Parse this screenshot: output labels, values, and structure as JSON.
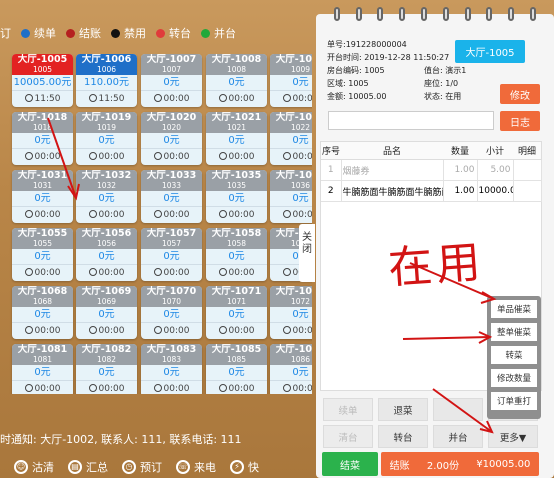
{
  "legend": [
    {
      "label": "订",
      "color": ""
    },
    {
      "label": "续单",
      "color": "#1f6fc8"
    },
    {
      "label": "结账",
      "color": "#b52020"
    },
    {
      "label": "禁用",
      "color": "#111111"
    },
    {
      "label": "转台",
      "color": "#e03b3b"
    },
    {
      "label": "并台",
      "color": "#22a83a"
    }
  ],
  "tables": [
    {
      "name": "大厅-1005",
      "code": "1005",
      "amount": "10005.00元",
      "time": "11:50",
      "status": "red"
    },
    {
      "name": "大厅-1006",
      "code": "1006",
      "amount": "110.00元",
      "time": "11:50",
      "status": "blue"
    },
    {
      "name": "大厅-1007",
      "code": "1007",
      "amount": "0元",
      "time": "00:00",
      "status": "idle"
    },
    {
      "name": "大厅-1008",
      "code": "1008",
      "amount": "0元",
      "time": "00:00",
      "status": "idle"
    },
    {
      "name": "大厅-1009",
      "code": "1009",
      "amount": "0元",
      "time": "00:00",
      "status": "idle"
    },
    {
      "name": "大厅-1018",
      "code": "1018",
      "amount": "0元",
      "time": "00:00",
      "status": "idle"
    },
    {
      "name": "大厅-1019",
      "code": "1019",
      "amount": "0元",
      "time": "00:00",
      "status": "idle"
    },
    {
      "name": "大厅-1020",
      "code": "1020",
      "amount": "0元",
      "time": "00:00",
      "status": "idle"
    },
    {
      "name": "大厅-1021",
      "code": "1021",
      "amount": "0元",
      "time": "00:00",
      "status": "idle"
    },
    {
      "name": "大厅-1022",
      "code": "1022",
      "amount": "0元",
      "time": "00:00",
      "status": "idle"
    },
    {
      "name": "大厅-1031",
      "code": "1031",
      "amount": "0元",
      "time": "00:00",
      "status": "idle"
    },
    {
      "name": "大厅-1032",
      "code": "1032",
      "amount": "0元",
      "time": "00:00",
      "status": "idle"
    },
    {
      "name": "大厅-1033",
      "code": "1033",
      "amount": "0元",
      "time": "00:00",
      "status": "idle"
    },
    {
      "name": "大厅-1035",
      "code": "1035",
      "amount": "0元",
      "time": "00:00",
      "status": "idle"
    },
    {
      "name": "大厅-1036",
      "code": "1036",
      "amount": "0元",
      "time": "00:00",
      "status": "idle"
    },
    {
      "name": "大厅-1055",
      "code": "1055",
      "amount": "0元",
      "time": "00:00",
      "status": "idle"
    },
    {
      "name": "大厅-1056",
      "code": "1056",
      "amount": "0元",
      "time": "00:00",
      "status": "idle"
    },
    {
      "name": "大厅-1057",
      "code": "1057",
      "amount": "0元",
      "time": "00:00",
      "status": "idle"
    },
    {
      "name": "大厅-1058",
      "code": "1058",
      "amount": "0元",
      "time": "00:00",
      "status": "idle"
    },
    {
      "name": "大厅-1059",
      "code": "1059",
      "amount": "0元",
      "time": "00:00",
      "status": "idle"
    },
    {
      "name": "大厅-1068",
      "code": "1068",
      "amount": "0元",
      "time": "00:00",
      "status": "idle"
    },
    {
      "name": "大厅-1069",
      "code": "1069",
      "amount": "0元",
      "time": "00:00",
      "status": "idle"
    },
    {
      "name": "大厅-1070",
      "code": "1070",
      "amount": "0元",
      "time": "00:00",
      "status": "idle"
    },
    {
      "name": "大厅-1071",
      "code": "1071",
      "amount": "0元",
      "time": "00:00",
      "status": "idle"
    },
    {
      "name": "大厅-1072",
      "code": "1072",
      "amount": "0元",
      "time": "00:00",
      "status": "idle"
    },
    {
      "name": "大厅-1081",
      "code": "1081",
      "amount": "0元",
      "time": "00:00",
      "status": "idle"
    },
    {
      "name": "大厅-1082",
      "code": "1082",
      "amount": "0元",
      "time": "00:00",
      "status": "idle"
    },
    {
      "name": "大厅-1083",
      "code": "1083",
      "amount": "0元",
      "time": "00:00",
      "status": "idle"
    },
    {
      "name": "大厅-1085",
      "code": "1085",
      "amount": "0元",
      "time": "00:00",
      "status": "idle"
    },
    {
      "name": "大厅-1086",
      "code": "1086",
      "amount": "0元",
      "time": "00:00",
      "status": "idle"
    }
  ],
  "side_tab": "关闭",
  "notice": "时通知: 大厅-1002, 联系人: 111, 联系电话: 111",
  "bottom_bar": [
    {
      "label": "沽清",
      "icon": "clean-icon"
    },
    {
      "label": "汇总",
      "icon": "summary-icon"
    },
    {
      "label": "预订",
      "icon": "clock-icon"
    },
    {
      "label": "来电",
      "icon": "phone-icon"
    },
    {
      "label": "快",
      "icon": "lightning-icon"
    }
  ],
  "order_info": {
    "order_no": "单号:191228000004",
    "open_time": "开台时间: 2019-12-28 11:50:27",
    "table_code": "房台编码: 1005",
    "waiter": "值台: 演示1",
    "area": "区域: 1005",
    "seats": "座位: 1/0",
    "amount": "金额: 10005.00",
    "status": "状态: 在用",
    "table_name": "大厅-1005",
    "edit_label": "修改",
    "log_label": "日志"
  },
  "order_table": {
    "headers": [
      "序号",
      "品名",
      "数量",
      "小计",
      "明细"
    ],
    "rows": [
      {
        "no": "1",
        "name": "烟藤券",
        "qty": "1.00",
        "subtotal": "5.00",
        "detail": "",
        "muted": true
      },
      {
        "no": "2",
        "name": "牛腩筋面牛腩筋面牛腩筋面",
        "qty": "1.00",
        "subtotal": "10000.0",
        "detail": "",
        "muted": false
      }
    ]
  },
  "popup_menu": [
    "单品催菜",
    "整单催菜",
    "转菜",
    "修改数量",
    "订单重打"
  ],
  "actions": {
    "row1": [
      "续单",
      "退菜",
      "",
      ""
    ],
    "row2": [
      "清台",
      "转台",
      "并台",
      "更多▼"
    ]
  },
  "footer": {
    "clean_label": "结菜",
    "checkout_label": "结账",
    "checkout_count": "2.00份",
    "checkout_total": "¥10005.00"
  },
  "annotation_text": "在用"
}
